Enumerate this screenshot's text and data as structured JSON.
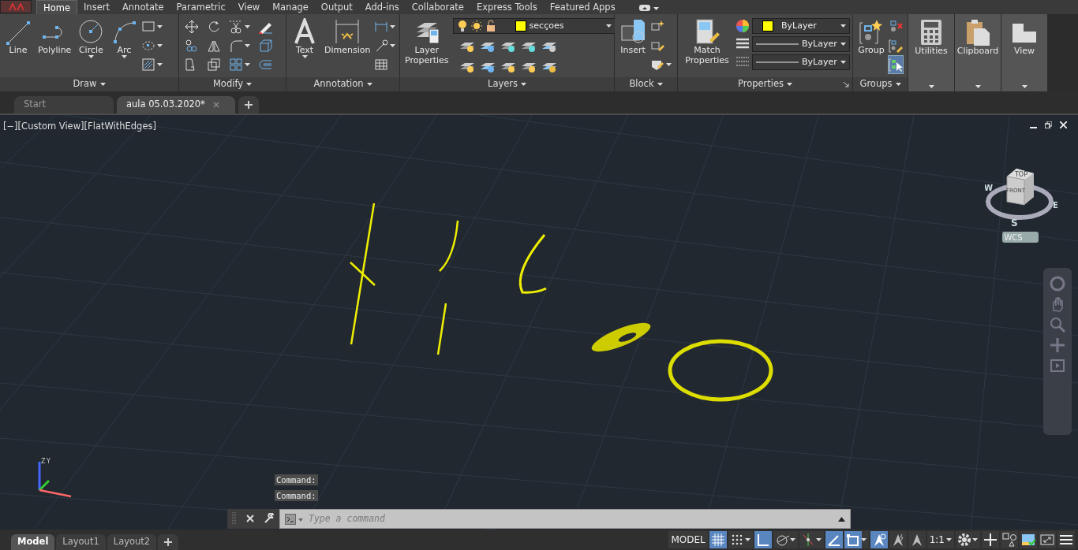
{
  "ribbon_tabs": [
    {
      "label": "Home",
      "selected": true
    },
    {
      "label": "Insert",
      "selected": false
    },
    {
      "label": "Annotate",
      "selected": false
    },
    {
      "label": "Parametric",
      "selected": false
    },
    {
      "label": "View",
      "selected": false
    },
    {
      "label": "Manage",
      "selected": false
    },
    {
      "label": "Output",
      "selected": false
    },
    {
      "label": "Add-ins",
      "selected": false
    },
    {
      "label": "Collaborate",
      "selected": false
    },
    {
      "label": "Express Tools",
      "selected": false
    },
    {
      "label": "Featured Apps",
      "selected": false
    }
  ],
  "panels": [
    {
      "kind": "tools",
      "title": "Draw",
      "menu": true,
      "large": [
        {
          "label": "Line",
          "menu": false
        },
        {
          "label": "Polyline",
          "menu": false
        },
        {
          "label": "Circle",
          "menu": true
        },
        {
          "label": "Arc",
          "menu": true
        }
      ]
    },
    {
      "kind": "tools",
      "title": "Modify",
      "menu": true
    },
    {
      "kind": "tools",
      "title": "Annotation",
      "menu": true,
      "large": [
        {
          "label": "Text",
          "menu": true
        },
        {
          "label": "Dimension",
          "menu": false
        }
      ]
    },
    {
      "kind": "layers",
      "title": "Layers",
      "menu": true,
      "large": [
        {
          "label": "Layer Properties",
          "menu": false
        }
      ],
      "layer": {
        "name": "secçoes",
        "color": "#ffff00"
      }
    },
    {
      "kind": "tools",
      "title": "Block",
      "menu": true,
      "large": [
        {
          "label": "Insert",
          "menu": false
        }
      ]
    },
    {
      "kind": "properties",
      "title": "Properties",
      "menu": true,
      "large": [
        {
          "label": "Match Properties",
          "menu": false
        }
      ],
      "color_field": {
        "value": "ByLayer",
        "color": "#ffff00"
      },
      "lineweight_field": {
        "value": "ByLayer"
      },
      "linetype_field": {
        "value": "ByLayer"
      }
    },
    {
      "kind": "tools",
      "title": "Groups",
      "menu": true,
      "large": [
        {
          "label": "Group",
          "menu": false
        }
      ]
    },
    {
      "kind": "collapsed",
      "title": "Utilities",
      "menu": true
    },
    {
      "kind": "collapsed",
      "title": "Clipboard",
      "menu": true
    },
    {
      "kind": "collapsed",
      "title": "View",
      "menu": true
    }
  ],
  "file_tabs": [
    {
      "label": "Start",
      "selected": false,
      "closable": false
    },
    {
      "label": "aula 05.03.2020*",
      "selected": true,
      "closable": true
    }
  ],
  "viewport": {
    "label": "[−][Custom View][FlatWithEdges]"
  },
  "viewcube": {
    "top": "TOP",
    "front": "FRONT",
    "west": "W",
    "east": "E",
    "south": "S",
    "ucs": "WCS"
  },
  "ucs_icon": {
    "z": "Z",
    "y": "Y"
  },
  "command_history": [
    "Command:",
    "Command:"
  ],
  "command_line": {
    "placeholder": "Type a command"
  },
  "layout_tabs": [
    {
      "label": "Model",
      "selected": true
    },
    {
      "label": "Layout1",
      "selected": false
    },
    {
      "label": "Layout2",
      "selected": false
    }
  ],
  "status_bar": {
    "mode": "MODEL",
    "items": [
      {
        "kind": "toggle",
        "on": true,
        "menu": false
      },
      {
        "kind": "toggle",
        "on": false,
        "menu": true
      },
      {
        "kind": "toggle",
        "on": true,
        "menu": false
      },
      {
        "kind": "toggle",
        "on": false,
        "menu": true
      },
      {
        "kind": "toggle",
        "on": false,
        "menu": true
      },
      {
        "kind": "toggle",
        "on": true,
        "menu": false
      },
      {
        "kind": "toggle",
        "on": true,
        "menu": true
      },
      {
        "kind": "toggle",
        "on": true,
        "menu": false
      },
      {
        "kind": "toggle",
        "on": false,
        "menu": false
      },
      {
        "kind": "toggle",
        "on": false,
        "menu": false
      },
      {
        "kind": "scale",
        "label": "1:1",
        "menu": true
      },
      {
        "kind": "toggle",
        "on": false,
        "menu": true
      },
      {
        "kind": "toggle",
        "on": false,
        "menu": false
      },
      {
        "kind": "toggle",
        "on": false,
        "menu": false
      },
      {
        "kind": "toggle",
        "on": false,
        "menu": false
      },
      {
        "kind": "toggle",
        "on": false,
        "menu": false
      },
      {
        "kind": "toggle",
        "on": false,
        "menu": false
      }
    ]
  }
}
